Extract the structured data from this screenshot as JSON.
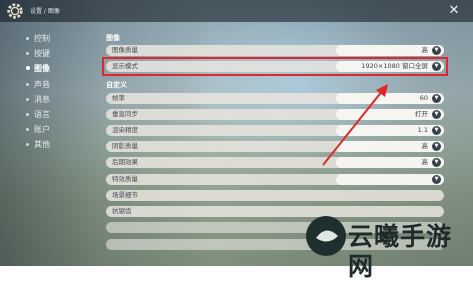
{
  "breadcrumb": "设置 / 图像",
  "close_glyph": "✕",
  "sidebar": {
    "items": [
      {
        "label": "控制",
        "active": false
      },
      {
        "label": "按键",
        "active": false
      },
      {
        "label": "图像",
        "active": true
      },
      {
        "label": "声音",
        "active": false
      },
      {
        "label": "消息",
        "active": false
      },
      {
        "label": "语言",
        "active": false
      },
      {
        "label": "账户",
        "active": false
      },
      {
        "label": "其他",
        "active": false
      }
    ]
  },
  "sections": {
    "graphics": "图像",
    "custom": "自定义"
  },
  "settings": [
    {
      "label": "图像质量",
      "value": "高"
    },
    {
      "label": "显示模式",
      "value": "1920×1080 窗口全屏"
    },
    {
      "label": "帧率",
      "value": "60"
    },
    {
      "label": "垂直同步",
      "value": "打开"
    },
    {
      "label": "渲染精度",
      "value": "1.1"
    },
    {
      "label": "阴影质量",
      "value": "高"
    },
    {
      "label": "后期效果",
      "value": "高"
    },
    {
      "label": "特效质量",
      "value": ""
    },
    {
      "label": "场景细节",
      "value": ""
    },
    {
      "label": "抗锯齿",
      "value": ""
    },
    {
      "label": "",
      "value": ""
    },
    {
      "label": "",
      "value": ""
    }
  ],
  "watermark": "云曦手游网",
  "colors": {
    "highlight": "#e0282a",
    "row_bg": "#e8e4de",
    "arrow_button": "#3b4350"
  },
  "icons": {
    "settings": "gear-icon",
    "close": "close-icon",
    "dropdown": "chevron-down-icon"
  }
}
